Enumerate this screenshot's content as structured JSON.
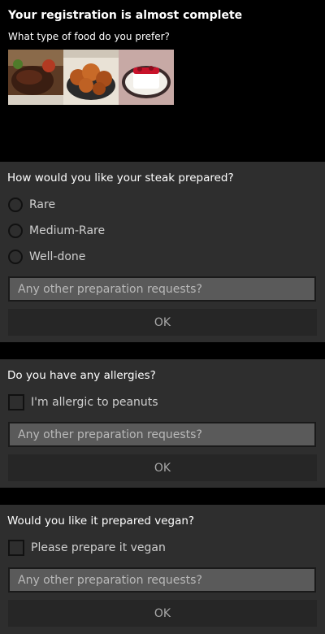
{
  "header": {
    "title": "Your registration is almost complete",
    "food_question": "What type of food do you prefer?",
    "food_images": [
      "steak-image",
      "fried-chicken-image",
      "dessert-image"
    ]
  },
  "steak_card": {
    "question": "How would you like your steak prepared?",
    "options": [
      "Rare",
      "Medium-Rare",
      "Well-done"
    ],
    "input_placeholder": "Any other preparation requests?",
    "ok_label": "OK"
  },
  "allergy_card": {
    "question": "Do you have any allergies?",
    "checkbox_label": "I'm allergic to peanuts",
    "input_placeholder": "Any other preparation requests?",
    "ok_label": "OK"
  },
  "vegan_card": {
    "question": "Would you like it prepared vegan?",
    "checkbox_label": "Please prepare it vegan",
    "input_placeholder": "Any other preparation requests?",
    "ok_label": "OK"
  },
  "colors": {
    "background": "#000000",
    "card": "#2e2e2e",
    "input": "#5a5a5a",
    "button": "#262626"
  }
}
